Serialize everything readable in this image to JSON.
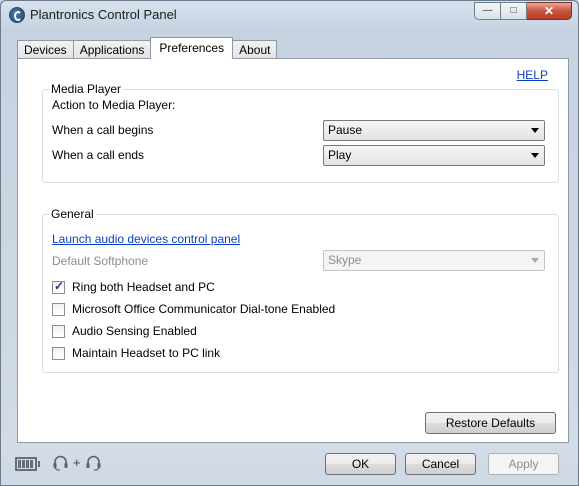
{
  "window": {
    "title": "Plantronics Control Panel"
  },
  "tabs": [
    {
      "label": "Devices"
    },
    {
      "label": "Applications"
    },
    {
      "label": "Preferences"
    },
    {
      "label": "About"
    }
  ],
  "help_link": "HELP",
  "media_player": {
    "group_label": "Media Player",
    "action_heading": "Action to Media Player:",
    "call_begins": {
      "label": "When a call begins",
      "selected": "Pause"
    },
    "call_ends": {
      "label": "When a call ends",
      "selected": "Play"
    }
  },
  "general": {
    "group_label": "General",
    "launch_link": "Launch audio devices control panel",
    "softphone": {
      "label": "Default Softphone",
      "selected": "Skype"
    },
    "checkboxes": [
      {
        "label": "Ring both Headset and PC",
        "checked": true
      },
      {
        "label": "Microsoft Office Communicator Dial-tone Enabled",
        "checked": false
      },
      {
        "label": "Audio Sensing Enabled",
        "checked": false
      },
      {
        "label": "Maintain Headset to PC link",
        "checked": false
      }
    ]
  },
  "buttons": {
    "restore": "Restore Defaults",
    "ok": "OK",
    "cancel": "Cancel",
    "apply": "Apply"
  },
  "status_icons": [
    "battery-icon",
    "headset-icon",
    "headset-icon"
  ]
}
